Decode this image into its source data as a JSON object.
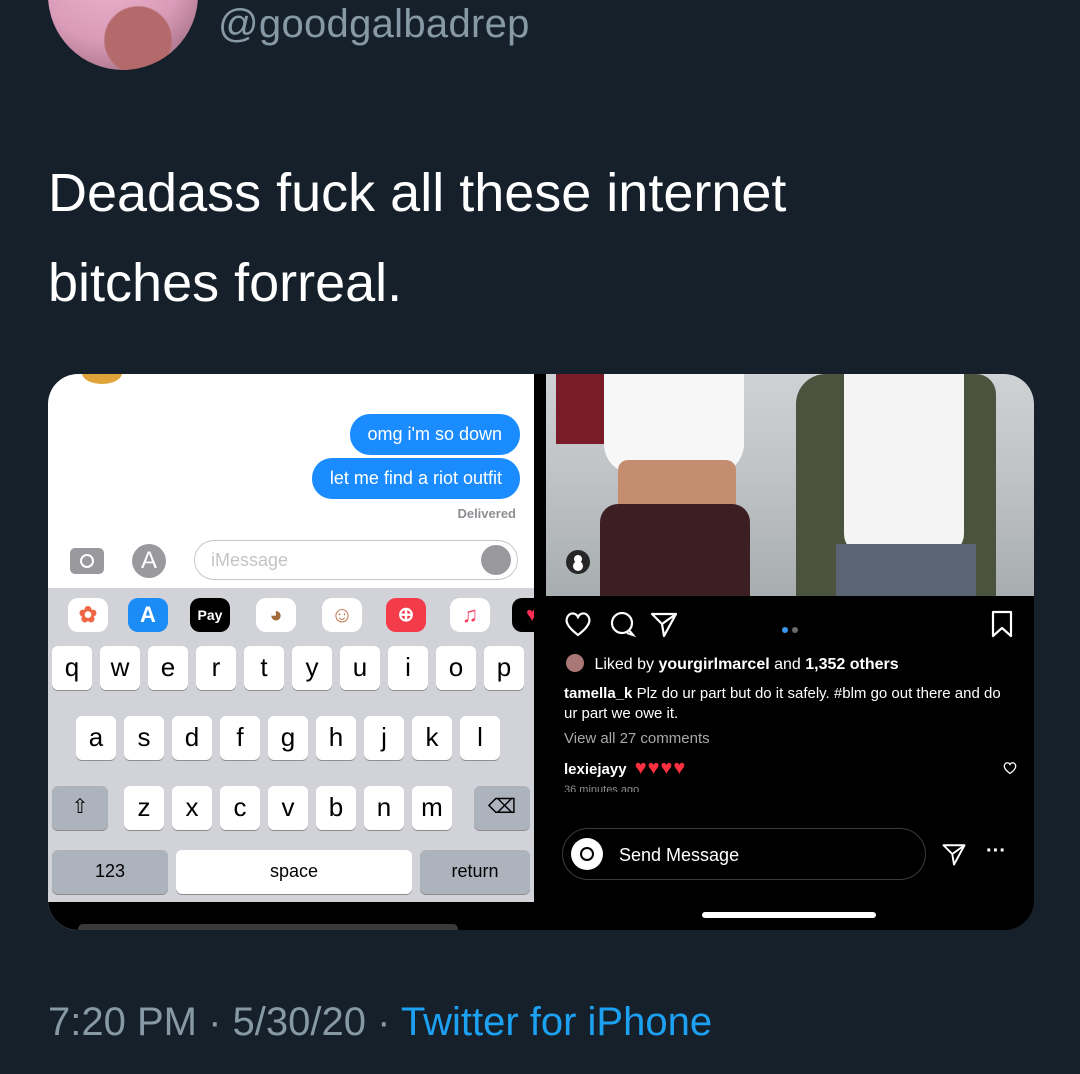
{
  "tweet": {
    "handle": "@goodgalbadrep",
    "text": "Deadass fuck all these internet bitches forreal.",
    "time": "7:20 PM",
    "date": "5/30/20",
    "source": "Twitter for iPhone",
    "link_color": "#1da1f2"
  },
  "imessage": {
    "messages": [
      "omg i'm so down",
      "let me find a riot outfit"
    ],
    "delivered": "Delivered",
    "input_placeholder": "iMessage",
    "app_bar": [
      "photos-icon",
      "appstore-icon",
      "Pay",
      "animoji-icon",
      "memoji-icon",
      "search-images-icon",
      "music-icon",
      "heart-icon"
    ],
    "keyboard": {
      "row1": [
        "q",
        "w",
        "e",
        "r",
        "t",
        "y",
        "u",
        "i",
        "o",
        "p"
      ],
      "row2": [
        "a",
        "s",
        "d",
        "f",
        "g",
        "h",
        "j",
        "k",
        "l"
      ],
      "row3": [
        "z",
        "x",
        "c",
        "v",
        "b",
        "n",
        "m"
      ],
      "numbers": "123",
      "space": "space",
      "return": "return"
    },
    "bubble_color": "#1a8cff"
  },
  "instagram": {
    "liked_prefix": "Liked by",
    "liked_user": "yourgirlmarcel",
    "liked_and": "and",
    "liked_count": "1,352 others",
    "caption_user": "tamella_k",
    "caption_text": "Plz do ur part but do it safely. #blm go out there and do ur part we owe it.",
    "view_all": "View all 27 comments",
    "comment_user": "lexiejayy",
    "comment_text": "♥♥♥♥",
    "time_ago": "36 minutes ago",
    "send_placeholder": "Send Message",
    "more": "···"
  }
}
